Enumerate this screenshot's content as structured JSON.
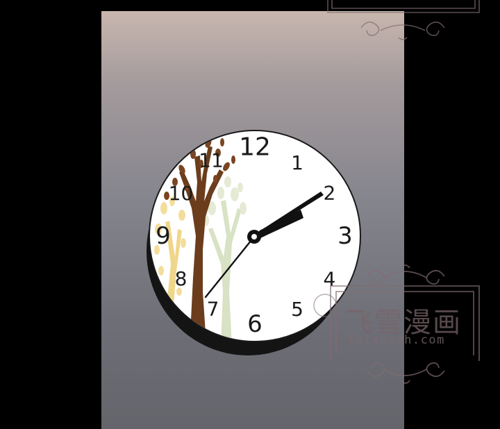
{
  "clock": {
    "numerals": [
      "12",
      "1",
      "2",
      "3",
      "4",
      "5",
      "6",
      "7",
      "8",
      "9",
      "10",
      "11"
    ]
  },
  "watermark": {
    "name": "飞雪漫画",
    "url": "feixuemh.com"
  },
  "colors": {
    "panel_top": "#c8b6ae",
    "panel_bottom": "#64646b",
    "clock_face": "#ffffff",
    "clock_shadow": "#141414",
    "hands": "#111111",
    "tree_trunk": "#6b3d1c",
    "tree_pale": "#d8e2c4",
    "tree_yellow": "#f0d68a",
    "watermark": "#7a6468"
  }
}
